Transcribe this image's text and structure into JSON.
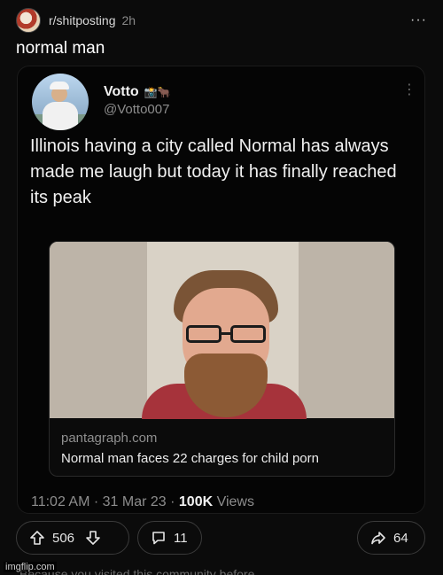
{
  "post": {
    "subreddit": "r/shitposting",
    "time": "2h",
    "title": "normal man",
    "more_icon": "more-horizontal-icon"
  },
  "tweet": {
    "display_name": "Votto",
    "name_emojis": "📸🐂",
    "handle": "@Votto007",
    "text": "Illinois having a city called Normal has always made me laugh but today it has finally reached its peak",
    "link_card": {
      "domain": "pantagraph.com",
      "title": "Normal man faces 22 charges for child porn"
    },
    "meta": {
      "timestamp": "11:02 AM · 31 Mar 23 · ",
      "views_count": "100K",
      "views_label": " Views"
    }
  },
  "actions": {
    "upvotes": "506",
    "comments": "11",
    "shares": "64"
  },
  "footer": {
    "note": "Because you visited this community before",
    "watermark": "imgflip.com"
  },
  "colors": {
    "background": "#0b0b0b",
    "embed_background": "#050505",
    "pill_border": "#3a3a3a",
    "muted_text": "#8d8d8d"
  }
}
